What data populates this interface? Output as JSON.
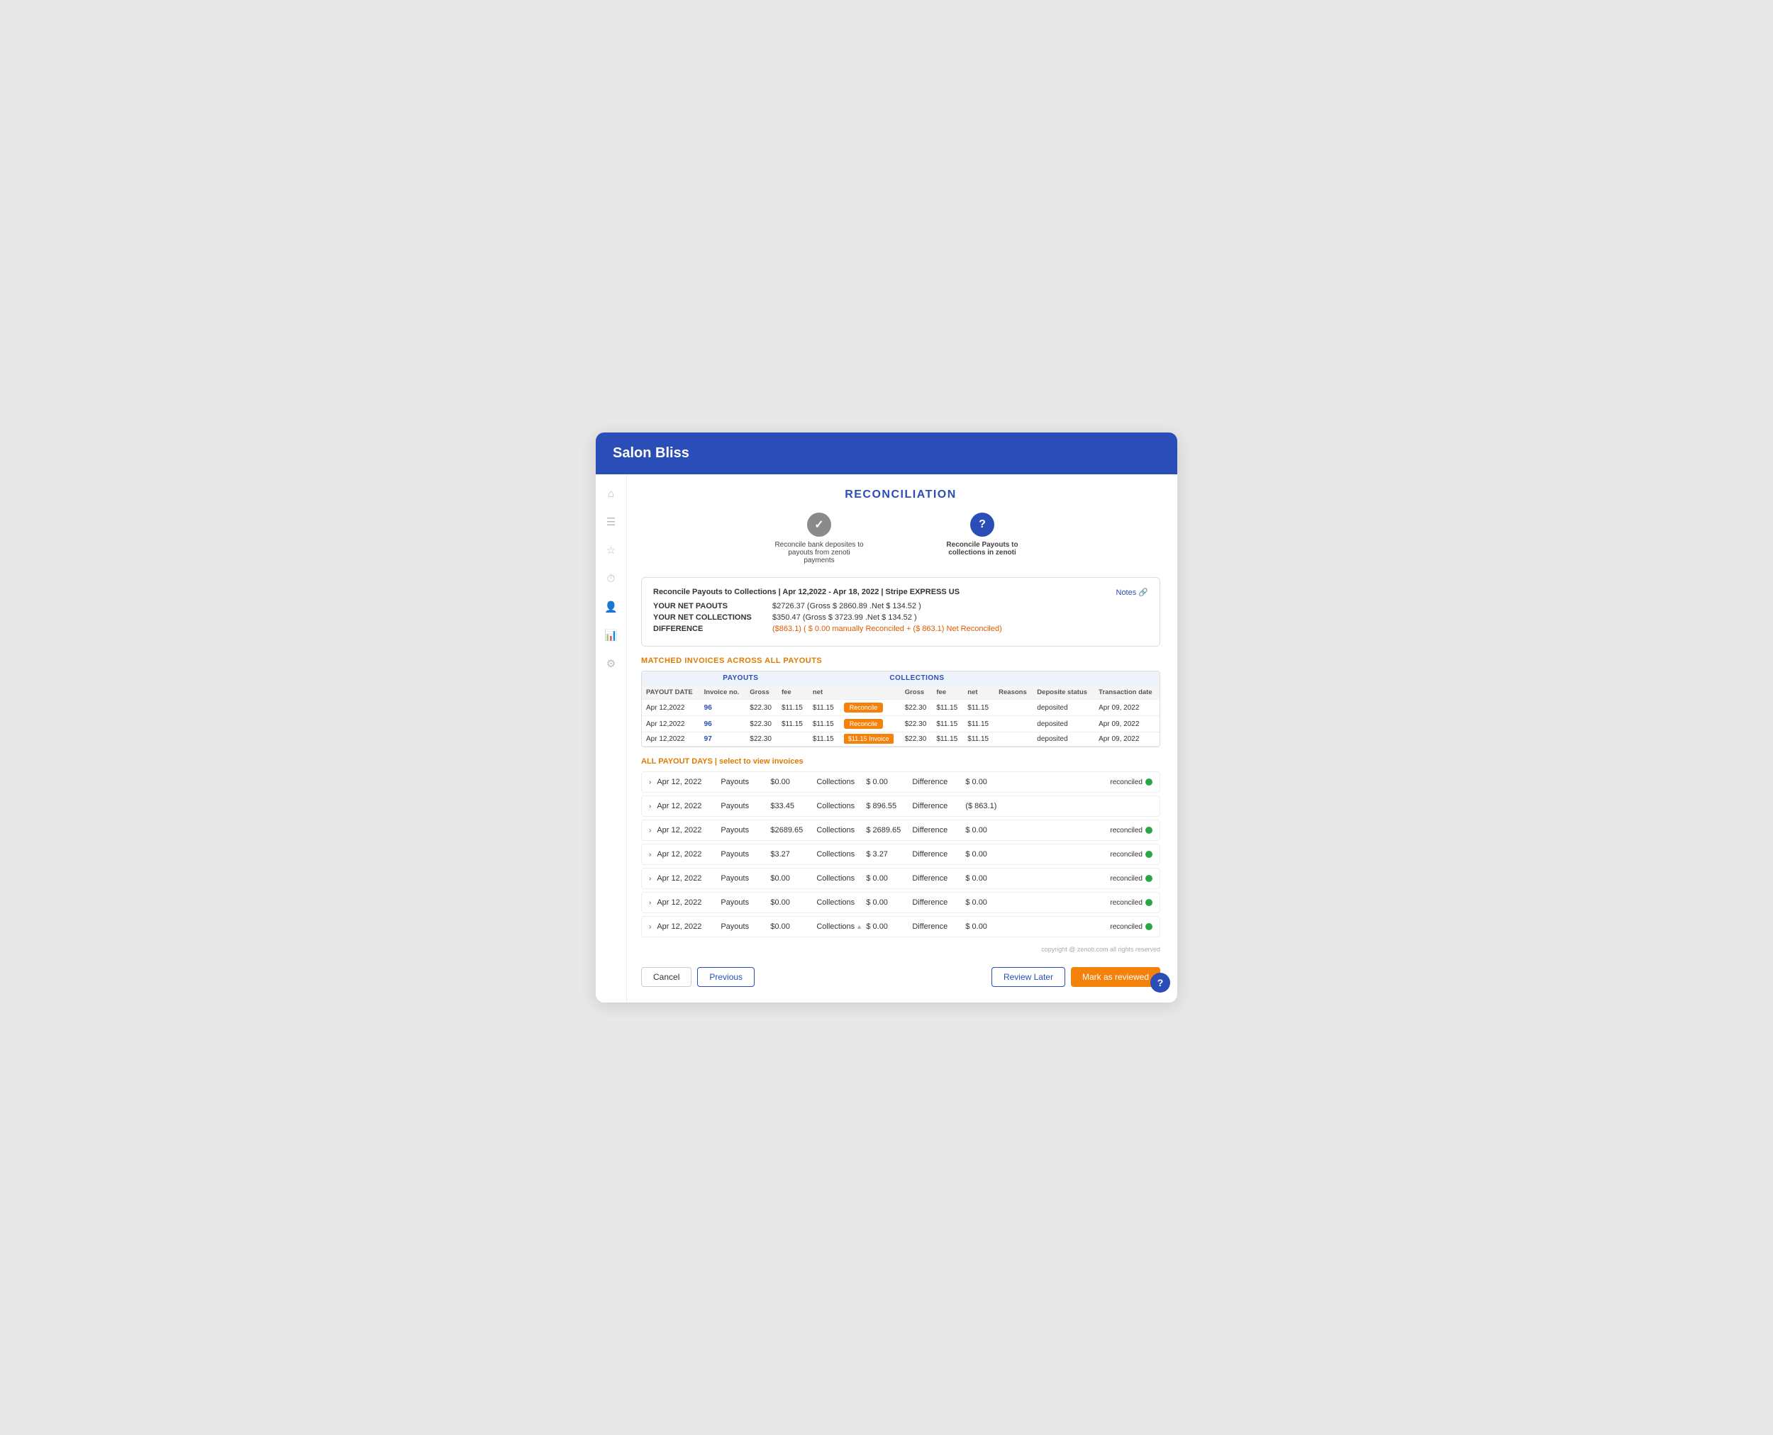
{
  "app": {
    "title": "Salon Bliss"
  },
  "page": {
    "title": "RECONCILIATION"
  },
  "steps": [
    {
      "id": "step1",
      "label": "Reconcile bank deposites to payouts from zenoti payments",
      "state": "done",
      "icon": "✓"
    },
    {
      "id": "step2",
      "label": "Reconcile Payouts to collections in zenoti",
      "state": "active",
      "icon": "?"
    }
  ],
  "infoBox": {
    "headerText": "Reconcile Payouts to Collections | Apr 12,2022 - Apr 18, 2022 | Stripe EXPRESS US",
    "rows": [
      {
        "label": "YOUR NET PAOUTS",
        "value": "$2726.37 (Gross $ 2860.89 .Net $ 134.52 )"
      },
      {
        "label": "YOUR NET COLLECTIONS",
        "value": "$350.47 (Gross $ 3723.99 .Net $ 134.52 )"
      },
      {
        "label": "DIFFERENCE",
        "value": "($863.1) ( $ 0.00 manually Reconciled + ($ 863.1) Net Reconciled)",
        "isRed": true
      }
    ],
    "notesLabel": "Notes 🔗"
  },
  "matchedSection": {
    "title": "MATCHED INVOICES ACROSS ALL PAYOUTS",
    "headers": {
      "payouts": "PAYOUTS",
      "collections": "COLLECTIONS"
    },
    "columns": [
      "PAYOUT DATE",
      "Invoice no.",
      "Gross",
      "fee",
      "net",
      "",
      "Gross",
      "fee",
      "net",
      "Reasons",
      "Deposite status",
      "Transaction date"
    ],
    "rows": [
      {
        "payoutDate": "Apr 12,2022",
        "invoiceNo": "96",
        "gross": "$22.30",
        "fee": "$11.15",
        "net": "$11.15",
        "btnType": "filled",
        "btnLabel": "Reconcile",
        "collGross": "$22.30",
        "collFee": "$11.15",
        "collNet": "$11.15",
        "reasons": "",
        "depositStatus": "deposited",
        "transactionDate": "Apr 09, 2022"
      },
      {
        "payoutDate": "Apr 12,2022",
        "invoiceNo": "96",
        "gross": "$22.30",
        "fee": "$11.15",
        "net": "$11.15",
        "btnType": "filled",
        "btnLabel": "Reconcile",
        "collGross": "$22.30",
        "collFee": "$11.15",
        "collNet": "$11.15",
        "reasons": "",
        "depositStatus": "deposited",
        "transactionDate": "Apr 09, 2022"
      },
      {
        "payoutDate": "Apr 12,2022",
        "invoiceNo": "97",
        "gross": "$22.30",
        "fee": "",
        "net": "$11.15",
        "btnType": "highlight",
        "btnLabel": "$11.15 Invoice",
        "collGross": "$22.30",
        "collFee": "$11.15",
        "collNet": "$11.15",
        "reasons": "",
        "depositStatus": "deposited",
        "transactionDate": "Apr 09, 2022"
      }
    ]
  },
  "payoutDaysSection": {
    "title": "ALL PAYOUT DAYS | select to view invoices",
    "rows": [
      {
        "date": "Apr 12, 2022",
        "payoutsLabel": "Payouts",
        "payoutsAmount": "$0.00",
        "collectionsLabel": "Collections",
        "collectionsAmount": "$ 0.00",
        "differenceLabel": "Difference",
        "differenceAmount": "$ 0.00",
        "status": "reconciled",
        "isReconciled": true
      },
      {
        "date": "Apr 12, 2022",
        "payoutsLabel": "Payouts",
        "payoutsAmount": "$33.45",
        "collectionsLabel": "Collections",
        "collectionsAmount": "$ 896.55",
        "differenceLabel": "Difference",
        "differenceAmount": "($ 863.1)",
        "status": "",
        "isReconciled": false
      },
      {
        "date": "Apr 12, 2022",
        "payoutsLabel": "Payouts",
        "payoutsAmount": "$2689.65",
        "collectionsLabel": "Collections",
        "collectionsAmount": "$ 2689.65",
        "differenceLabel": "Difference",
        "differenceAmount": "$ 0.00",
        "status": "reconciled",
        "isReconciled": true
      },
      {
        "date": "Apr 12, 2022",
        "payoutsLabel": "Payouts",
        "payoutsAmount": "$3.27",
        "collectionsLabel": "Collections",
        "collectionsAmount": "$ 3.27",
        "differenceLabel": "Difference",
        "differenceAmount": "$ 0.00",
        "status": "reconciled",
        "isReconciled": true
      },
      {
        "date": "Apr 12, 2022",
        "payoutsLabel": "Payouts",
        "payoutsAmount": "$0.00",
        "collectionsLabel": "Collections",
        "collectionsAmount": "$ 0.00",
        "differenceLabel": "Difference",
        "differenceAmount": "$ 0.00",
        "status": "reconciled",
        "isReconciled": true
      },
      {
        "date": "Apr 12, 2022",
        "payoutsLabel": "Payouts",
        "payoutsAmount": "$0.00",
        "collectionsLabel": "Collections",
        "collectionsAmount": "$ 0.00",
        "differenceLabel": "Difference",
        "differenceAmount": "$ 0.00",
        "status": "reconciled",
        "isReconciled": true
      },
      {
        "date": "Apr 12, 2022",
        "payoutsLabel": "Payouts",
        "payoutsAmount": "$0.00",
        "collectionsLabel": "Collections",
        "collectionsAmount": "$ 0.00",
        "differenceLabel": "Difference",
        "differenceAmount": "$ 0.00",
        "status": "reconciled",
        "isReconciled": true,
        "hasIcon": true
      }
    ]
  },
  "copyright": "copyright @ zenoti.com all rights reserved",
  "footer": {
    "cancelLabel": "Cancel",
    "previousLabel": "Previous",
    "reviewLaterLabel": "Review Later",
    "markAsReviewedLabel": "Mark as reviewed"
  },
  "sidebar": {
    "icons": [
      {
        "name": "home-icon",
        "glyph": "⌂"
      },
      {
        "name": "list-icon",
        "glyph": "☰"
      },
      {
        "name": "star-icon",
        "glyph": "☆"
      },
      {
        "name": "clock-icon",
        "glyph": "⏱"
      },
      {
        "name": "person-icon",
        "glyph": "👤"
      },
      {
        "name": "chart-icon",
        "glyph": "📊"
      },
      {
        "name": "settings-icon",
        "glyph": "⚙"
      }
    ]
  },
  "helpBtn": "?"
}
